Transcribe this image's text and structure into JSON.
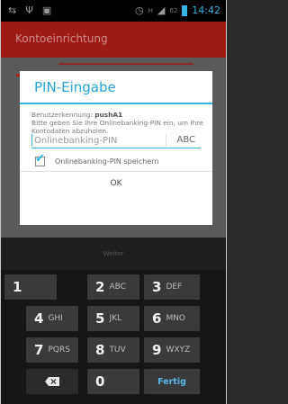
{
  "status_bar": {
    "time": "14:42",
    "signal_label": "H",
    "battery_level": "62"
  },
  "app": {
    "title": "Kontoeinrichtung"
  },
  "dialog": {
    "title": "PIN-Eingabe",
    "user_label": "Benutzerkennung:",
    "user_value": "pushA1",
    "hint": "Bitte geben Sie Ihre Onlinebanking-PIN ein, um Ihre Kontodaten abzuholen.",
    "pin_placeholder": "Onlinebanking-PIN",
    "pin_mode": "ABC",
    "save_checkbox_label": "Onlinebanking-PIN speichern",
    "save_checked": true,
    "ok_label": "OK"
  },
  "weiter_label": "Weiter",
  "keyboard": {
    "rows": [
      [
        {
          "digit": "1",
          "letters": ""
        },
        {
          "digit": "2",
          "letters": "ABC"
        },
        {
          "digit": "3",
          "letters": "DEF"
        }
      ],
      [
        {
          "digit": "4",
          "letters": "GHI"
        },
        {
          "digit": "5",
          "letters": "JKL"
        },
        {
          "digit": "6",
          "letters": "MNO"
        }
      ],
      [
        {
          "digit": "7",
          "letters": "PQRS"
        },
        {
          "digit": "8",
          "letters": "TUV"
        },
        {
          "digit": "9",
          "letters": "WXYZ"
        }
      ]
    ],
    "zero": "0",
    "done_label": "Fertig"
  },
  "colors": {
    "accent": "#33b5e5",
    "app_bar": "#9e1b14"
  }
}
